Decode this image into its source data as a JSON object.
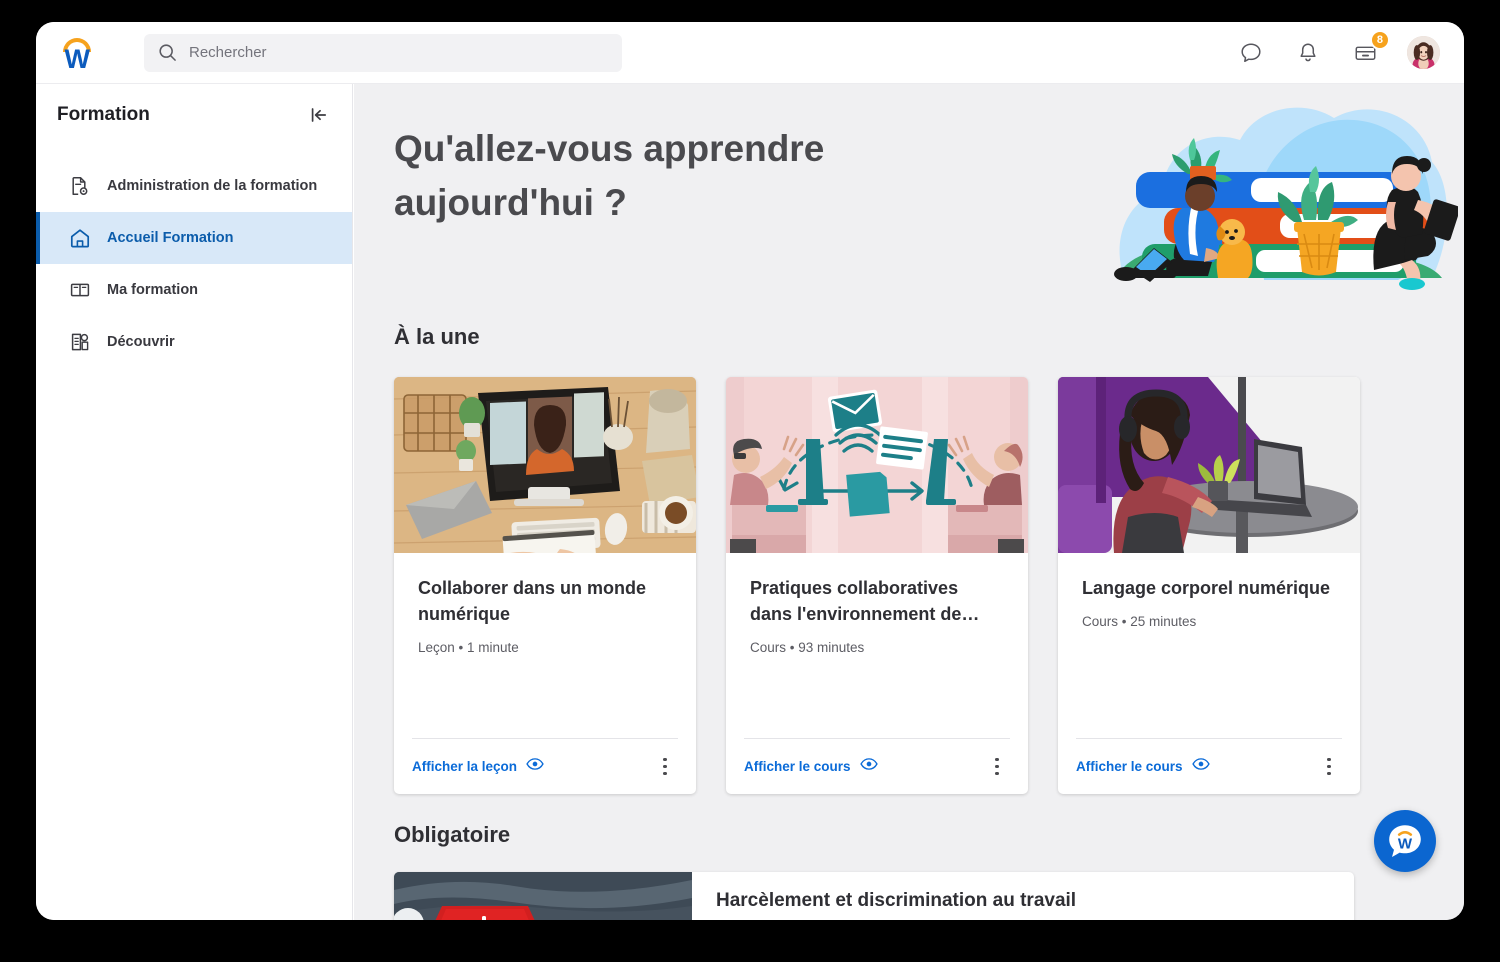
{
  "brand": {
    "logo_name": "workday-logo",
    "logo_letter": "W",
    "accent_orange": "#f6a21d",
    "accent_blue": "#0c5bbd"
  },
  "topbar": {
    "search": {
      "placeholder": "Rechercher",
      "value": "",
      "icon": "search-icon"
    },
    "actions": [
      {
        "name": "chat-icon",
        "label": ""
      },
      {
        "name": "notifications-bell-icon",
        "label": ""
      },
      {
        "name": "inbox-tray-icon",
        "label": "",
        "badge": "8"
      }
    ],
    "avatar_alt": "avatar"
  },
  "sidebar": {
    "title": "Formation",
    "collapse_icon": "collapse-panel-icon",
    "items": [
      {
        "label": "Administration de la formation",
        "icon": "document-settings-icon",
        "active": false
      },
      {
        "label": "Accueil Formation",
        "icon": "home-icon",
        "active": true
      },
      {
        "label": "Ma formation",
        "icon": "open-book-icon",
        "active": false
      },
      {
        "label": "Découvrir",
        "icon": "discover-document-icon",
        "active": false
      }
    ]
  },
  "main": {
    "hero": {
      "title": "Qu'allez-vous apprendre aujourd'hui ?",
      "illustration": "learning-books-illustration"
    },
    "featured": {
      "heading": "À la une",
      "cards": [
        {
          "title": "Collaborer dans un monde numérique",
          "meta": "Leçon • 1 minute",
          "action_label": "Afficher la leçon",
          "action_icon": "eye-icon",
          "menu_icon": "kebab-menu-icon",
          "thumb": "desk-videocall-photo"
        },
        {
          "title": "Pratiques collaboratives dans l'environnement de…",
          "meta": "Cours • 93 minutes",
          "action_label": "Afficher le cours",
          "action_icon": "eye-icon",
          "menu_icon": "kebab-menu-icon",
          "thumb": "collaboration-illustration"
        },
        {
          "title": "Langage corporel numérique",
          "meta": "Cours • 25 minutes",
          "action_label": "Afficher le cours",
          "action_icon": "eye-icon",
          "menu_icon": "kebab-menu-icon",
          "thumb": "woman-laptop-photo"
        }
      ]
    },
    "required": {
      "heading": "Obligatoire",
      "items": [
        {
          "title": "Harcèlement et discrimination au travail",
          "thumb": "stop-sign-photo"
        }
      ]
    }
  },
  "assistant": {
    "name": "workday-assistant",
    "letter": "W"
  }
}
